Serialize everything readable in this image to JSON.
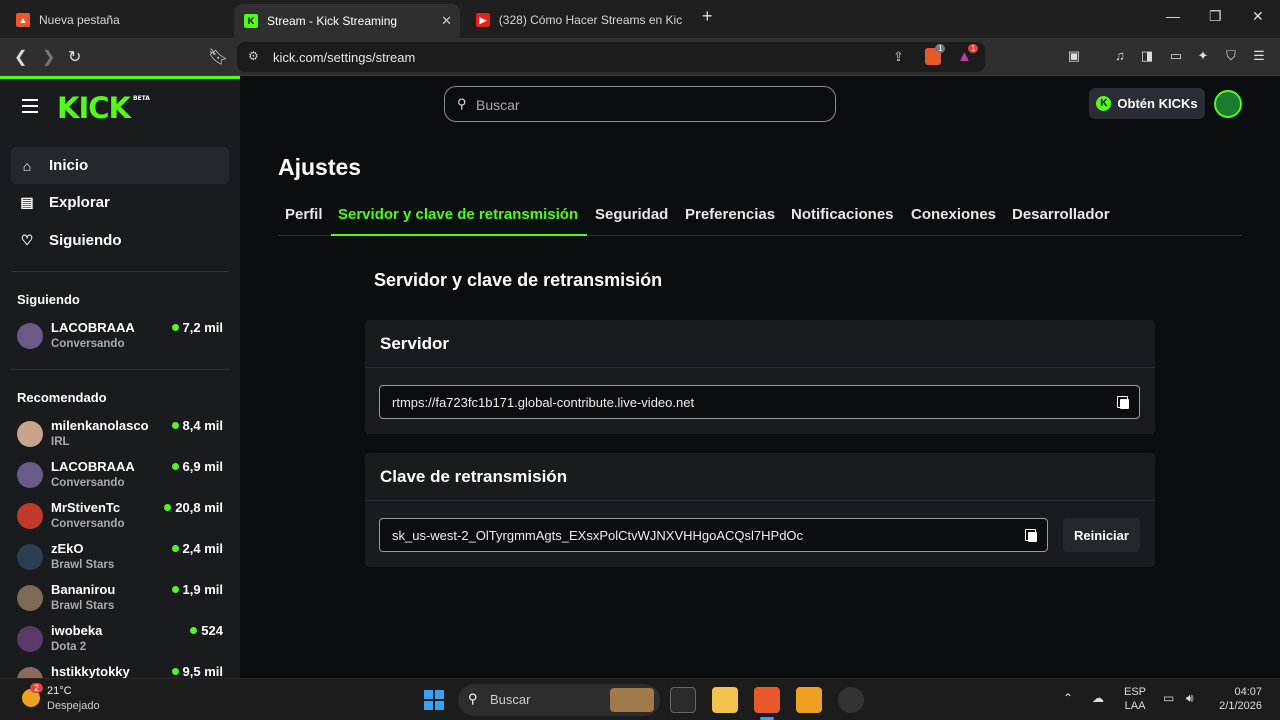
{
  "browser": {
    "tabs": [
      {
        "title": "Nueva pestaña"
      },
      {
        "title": "Stream - Kick Streaming"
      },
      {
        "title": "(328) Cómo Hacer Streams en Kick (C"
      }
    ],
    "new_tab_label": "+",
    "url": "kick.com/settings/stream",
    "brave_badge": "1",
    "alert_badge": "1"
  },
  "header": {
    "logo": "KICK",
    "logo_beta": "BETA",
    "search_placeholder": "Buscar",
    "kicks_button": "Obtén KICKs",
    "kicks_icon_letter": "K"
  },
  "sidebar": {
    "nav": [
      {
        "label": "Inicio",
        "icon": "home-icon"
      },
      {
        "label": "Explorar",
        "icon": "explore-icon"
      },
      {
        "label": "Siguiendo",
        "icon": "heart-icon"
      }
    ],
    "following_title": "Siguiendo",
    "following": [
      {
        "name": "LACOBRAAA",
        "category": "Conversando",
        "viewers": "7,2 mil",
        "color": "#6a5a8a"
      }
    ],
    "recommended_title": "Recomendado",
    "recommended": [
      {
        "name": "milenkanolasco",
        "category": "IRL",
        "viewers": "8,4 mil",
        "color": "#c9a48a"
      },
      {
        "name": "LACOBRAAA",
        "category": "Conversando",
        "viewers": "6,9 mil",
        "color": "#6a5a8a"
      },
      {
        "name": "MrStivenTc",
        "category": "Conversando",
        "viewers": "20,8 mil",
        "color": "#c0392b"
      },
      {
        "name": "zEkO",
        "category": "Brawl Stars",
        "viewers": "2,4 mil",
        "color": "#2c3e50"
      },
      {
        "name": "Bananirou",
        "category": "Brawl Stars",
        "viewers": "1,9 mil",
        "color": "#7f6a55"
      },
      {
        "name": "iwobeka",
        "category": "Dota 2",
        "viewers": "524",
        "color": "#5a3a6a"
      },
      {
        "name": "hstikkytokky",
        "category": "",
        "viewers": "9,5 mil",
        "color": "#8a6a5a"
      }
    ]
  },
  "settings": {
    "title": "Ajustes",
    "tabs": [
      "Perfil",
      "Servidor y clave de retransmisión",
      "Seguridad",
      "Preferencias",
      "Notificaciones",
      "Conexiones",
      "Desarrollador"
    ],
    "active_tab": "Servidor y clave de retransmisión",
    "section_title": "Servidor y clave de retransmisión",
    "server_label": "Servidor",
    "server_value": "rtmps://fa723fc1b171.global-contribute.live-video.net",
    "key_label": "Clave de retransmisión",
    "key_value": "sk_us-west-2_OlTyrgmmAgts_EXsxPolCtvWJNXVHHgoACQsl7HPdOc",
    "reset_label": "Reiniciar"
  },
  "taskbar": {
    "weather_temp": "21°C",
    "weather_desc": "Despejado",
    "weather_badge": "2",
    "search_placeholder": "Buscar",
    "lang_top": "ESP",
    "lang_bottom": "LAA",
    "time": "04:07",
    "date": "2/1/2026"
  },
  "colors": {
    "accent": "#53fc18",
    "bg": "#0b0e0f",
    "panel": "#191b1f"
  }
}
